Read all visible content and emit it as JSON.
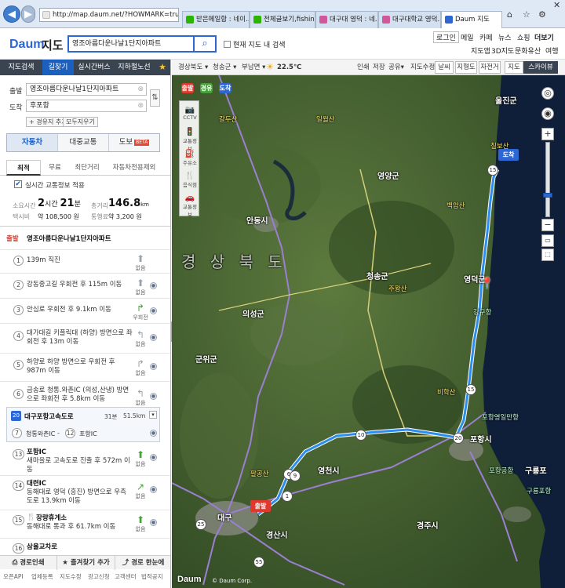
{
  "browser": {
    "url": "http://map.daum.net/?HOWMARK=tru",
    "tabs": [
      {
        "label": "받은메일함 : 네이...",
        "color": "#2db400"
      },
      {
        "label": "전체글보기,fishin...",
        "color": "#2db400"
      },
      {
        "label": "대구대 영덕 : 네...",
        "color": "#d0579a"
      },
      {
        "label": "대구대학교 영덕...",
        "color": "#d0579a"
      },
      {
        "label": "Daum 지도",
        "color": "#2c67d4"
      }
    ]
  },
  "header": {
    "logo": "Daum",
    "service": "지도",
    "search_value": "영조아름다운나날1단지아파트",
    "checkbox_label": "현재 지도 내 검색",
    "links_row1": [
      "로그인",
      "메일",
      "카페",
      "뉴스",
      "쇼핑",
      "더보기"
    ],
    "links_row2": [
      "지도앱",
      "3D지도",
      "문화유산",
      "여행"
    ]
  },
  "left_tabs": [
    "지도검색",
    "길찾기",
    "실시간버스",
    "지하철노선"
  ],
  "route_form": {
    "origin_label": "출발",
    "origin_value": "영조아름다운나날1단지아파트",
    "dest_label": "도착",
    "dest_value": "후포항",
    "add_waypoint": "+ 경유지 추가",
    "clear_all": "모두지우기"
  },
  "modes": [
    "자동차",
    "대중교통",
    "도보"
  ],
  "beta": "BETA",
  "subtabs": [
    "최적",
    "무료",
    "최단거리",
    "자동차전용제외"
  ],
  "traffic_check": "실시간 교통정보 적용",
  "summary": {
    "time_label": "소요시간",
    "time_h": "2",
    "time_h_unit": "시간",
    "time_m": "21",
    "time_m_unit": "분",
    "dist_label": "총거리",
    "dist_value": "146.8",
    "dist_unit": "km",
    "taxi_label": "택시비",
    "taxi_value": "약 108,500 원",
    "toll_label": "통행료",
    "toll_value": "약 3,200 원"
  },
  "start_tag": "출발",
  "start_name": "영조아름다운나날1단지아파트",
  "steps": [
    {
      "n": "1",
      "text": "139m 직진",
      "turn": "없음"
    },
    {
      "n": "2",
      "text": "강동중고길 우회전 후 115m 이동",
      "turn": "없음"
    },
    {
      "n": "3",
      "text": "안심로 우회전 후 9.1km 이동",
      "turn": "우회전"
    },
    {
      "n": "4",
      "text": "대가대길 키플릭대 (하양) 방면으로 좌회전 후 13m 이동",
      "turn": "없음"
    },
    {
      "n": "5",
      "text": "하양로 하양 방면으로 우회전 후 987m 이동",
      "turn": "없음"
    },
    {
      "n": "6",
      "text": "금송로 청통.와촌IC (의성,산냉) 방면으로 좌회전 후 5.8km 이동",
      "turn": "없음"
    }
  ],
  "highway": {
    "badge": "20",
    "name": "대구포항고속도로",
    "time": "31분",
    "dist": "51.5km",
    "from_n": "7",
    "from": "청통와촌IC",
    "to_n": "12",
    "to": "포항IC"
  },
  "steps2": [
    {
      "n": "13",
      "title": "포항IC",
      "text": "새마을로 고속도로 진출 후 572m 이동",
      "turn": "없음"
    },
    {
      "n": "14",
      "title": "대련IC",
      "text": "동해대로 영덕 (흥진) 방면으로 우측 도로 13.9km 이동",
      "turn": "없음"
    },
    {
      "n": "15",
      "title": "장량휴게소",
      "text": "동해대로 통과 후 61.7km 이동",
      "turn": "없음"
    },
    {
      "n": "16",
      "title": "삼율교차로",
      "text": "",
      "turn": ""
    }
  ],
  "bottom_buttons": [
    "경로인쇄",
    "즐겨찾기 추가",
    "경로 한눈에"
  ],
  "footer_links": [
    "오픈API",
    "업체등록",
    "지도수정",
    "광고신청",
    "고객센터",
    "법적공지"
  ],
  "map_toolbar": {
    "region1": "경상북도",
    "region2": "청송군",
    "region3": "부남면",
    "weather": "22.5℃",
    "actions": [
      "인쇄",
      "저장",
      "공유",
      "지도수정"
    ],
    "layers": [
      "날씨",
      "지형도",
      "자전거"
    ],
    "view_map": "지도",
    "view_sky": "스카이뷰"
  },
  "map_tags": [
    "출발",
    "경유",
    "도착"
  ],
  "left_tools": [
    "CCTV",
    "교통정보",
    "주유소",
    "음식점",
    "교통정보"
  ],
  "map_labels": {
    "province": "경 상 북 도",
    "cities": [
      "안동시",
      "영천시",
      "대구",
      "경산시",
      "포항시",
      "경주시",
      "영덕군",
      "울진군",
      "영양군",
      "청송군",
      "의성군",
      "군위군",
      "구룡포"
    ],
    "places": [
      "갈두산",
      "일월산",
      "주왕산",
      "팔공산",
      "비학산",
      "포항영일만항",
      "포항공항",
      "칠보산",
      "백암산",
      "강구항",
      "구룡포항"
    ],
    "start_marker": "출발",
    "end_marker": "도착",
    "hw_numbers": [
      "1",
      "6",
      "9",
      "10",
      "15",
      "15",
      "20",
      "25",
      "55"
    ]
  },
  "map_footer": "© Daum Corp."
}
